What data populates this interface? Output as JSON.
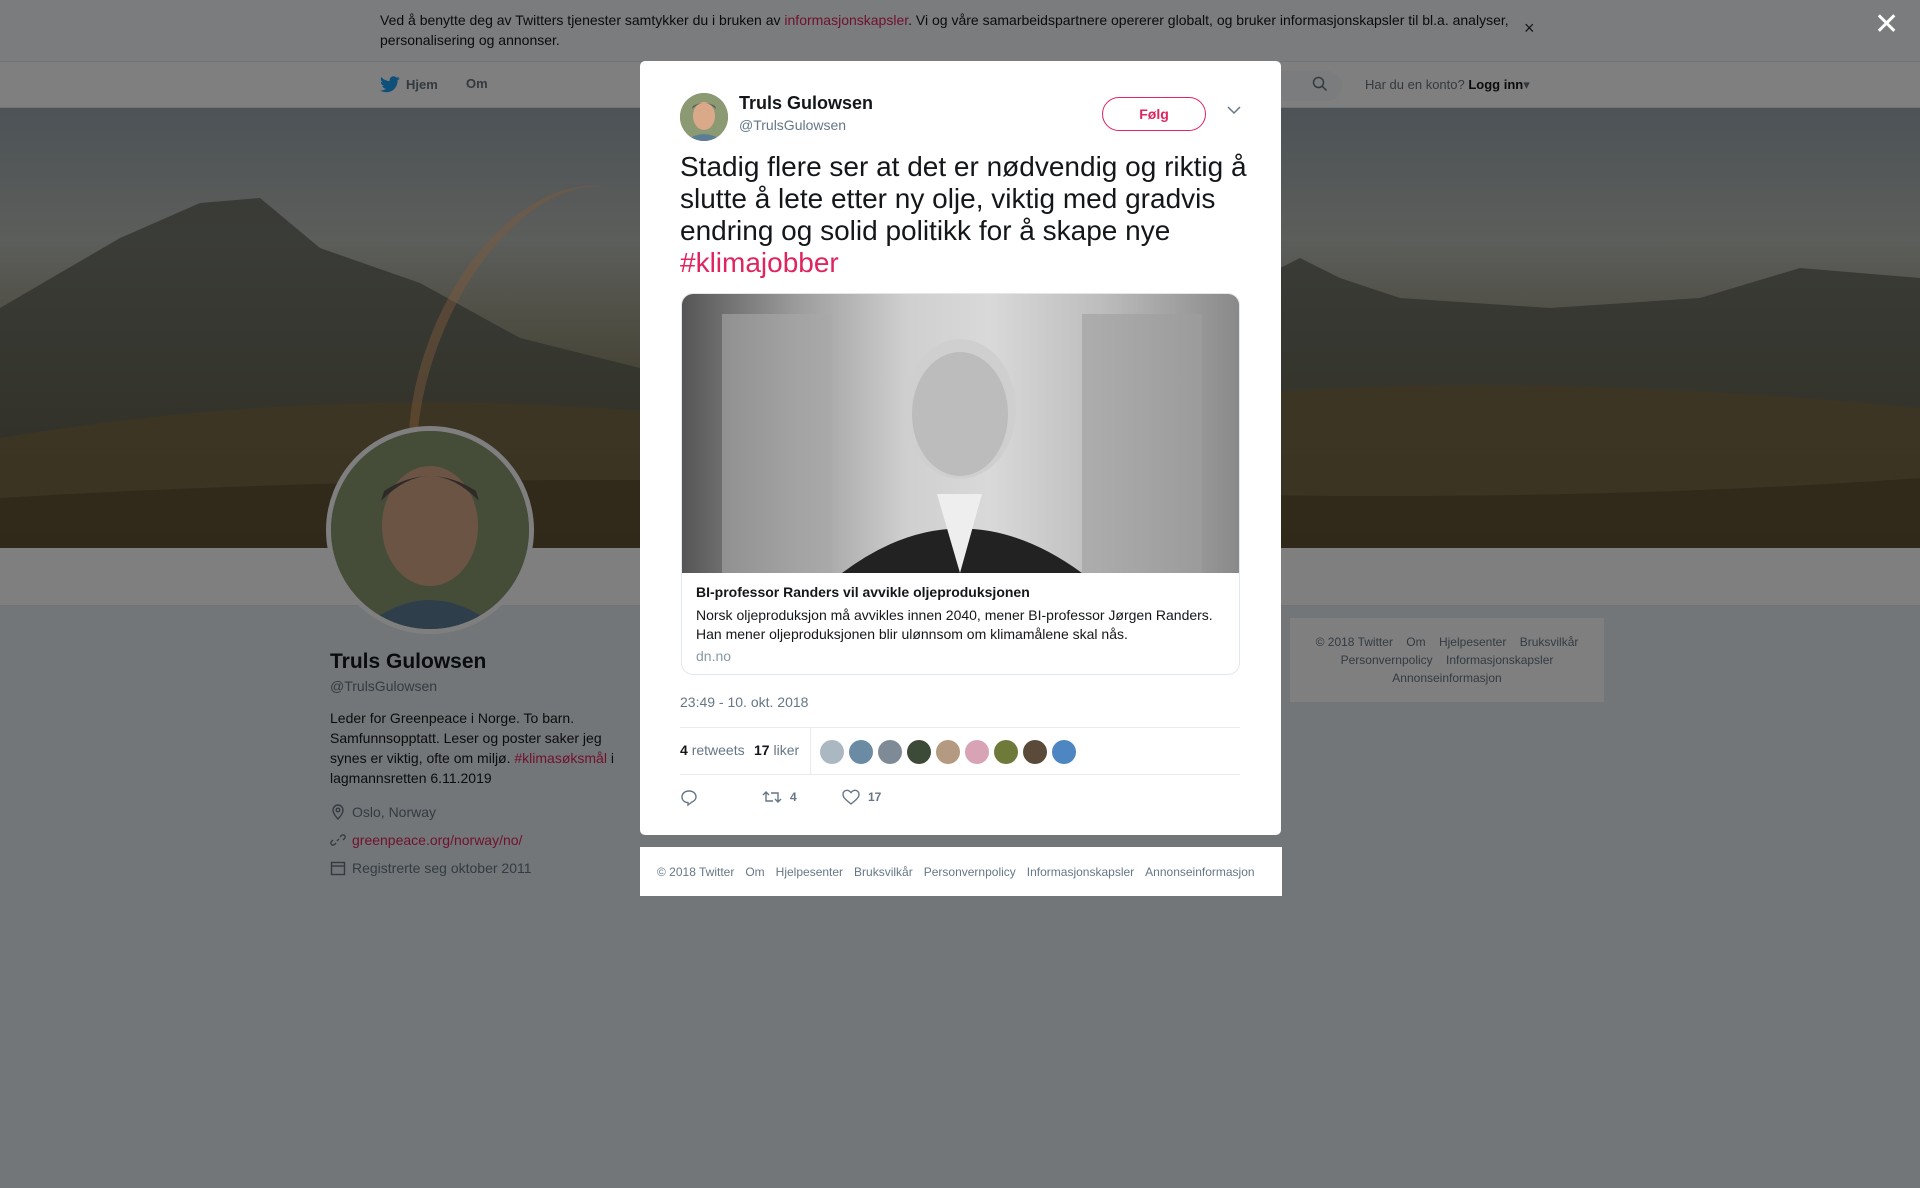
{
  "cookie": {
    "text_before": "Ved å benytte deg av Twitters tjenester samtykker du i bruken av ",
    "link": "informasjonskapsler",
    "text_after": ". Vi og våre samarbeidspartnere opererer globalt, og bruker informasjonskapsler til bl.a. analyser, personalisering og annonser."
  },
  "nav": {
    "home": "Hjem",
    "about": "Om",
    "login_prompt": "Har du en konto?",
    "login_label": "Logg inn"
  },
  "profile": {
    "name": "Truls Gulowsen",
    "handle": "@TrulsGulowsen",
    "bio_before": "Leder for Greenpeace i Norge. To barn. Samfunnsopptatt. Leser og poster saker jeg synes er viktig, ofte om miljø. ",
    "bio_tag": "#klimasøksmål",
    "bio_after": " i lagmannsretten 6.11.2019",
    "location": "Oslo, Norway",
    "website": "greenpeace.org/norway/no/",
    "joined": "Registrerte seg oktober 2011"
  },
  "side_footer": {
    "items": [
      "© 2018 Twitter",
      "Om",
      "Hjelpesenter",
      "Bruksvilkår",
      "Personvernpolicy",
      "Informasjonskapsler",
      "Annonseinformasjon"
    ]
  },
  "tweet": {
    "author_name": "Truls Gulowsen",
    "author_handle": "@TrulsGulowsen",
    "follow_label": "Følg",
    "text": "Stadig flere ser at det er nødvendig og riktig å slutte å lete etter ny olje, viktig med gradvis endring og solid politikk for å skape nye ",
    "hashtag": "#klimajobber",
    "card": {
      "title": "BI-professor Randers vil avvikle oljeproduksjonen",
      "description": "Norsk oljeproduksjon må avvikles innen 2040, mener BI-professor Jørgen Randers. Han mener oljeproduksjonen blir ulønnsom om klimamålene skal nås.",
      "domain": "dn.no"
    },
    "timestamp": "23:49 - 10. okt. 2018",
    "retweets_count": "4",
    "retweets_label": "retweets",
    "likes_count": "17",
    "likes_label": "liker",
    "action_retweets": "4",
    "action_likes": "17"
  },
  "modal_footer": {
    "items": [
      "© 2018 Twitter",
      "Om",
      "Hjelpesenter",
      "Bruksvilkår",
      "Personvernpolicy",
      "Informasjonskapsler",
      "Annonseinformasjon"
    ]
  },
  "colors": {
    "accent": "#e0245e",
    "text": "#14171a",
    "muted": "#657786"
  }
}
